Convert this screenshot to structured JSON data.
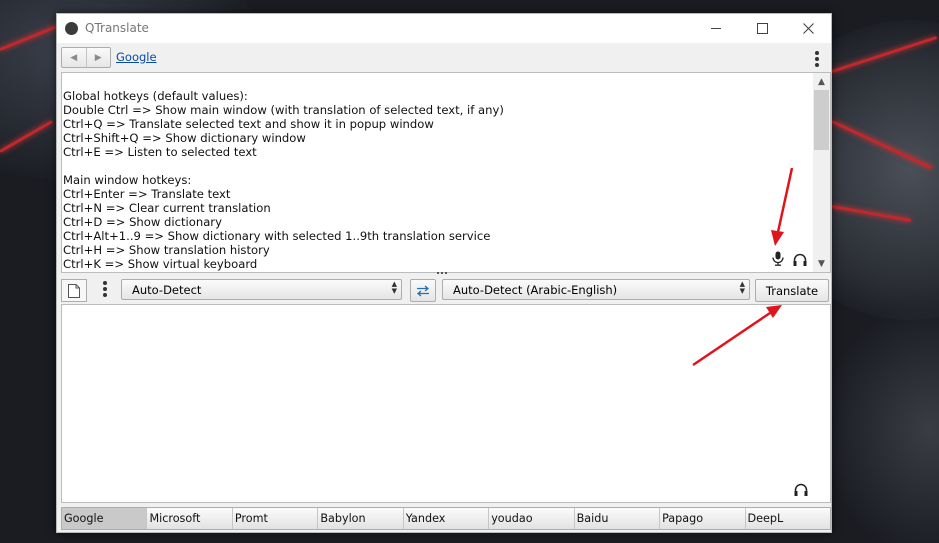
{
  "window": {
    "title": "QTranslate",
    "minimize": "minimize-icon",
    "maximize": "maximize-icon",
    "close": "close-icon"
  },
  "toolbar": {
    "back_icon": "chevron-left-icon",
    "forward_icon": "chevron-right-icon",
    "service_link": "Google",
    "menu_icon": "vertical-dots-icon"
  },
  "source": {
    "text": "Global hotkeys (default values):\nDouble Ctrl => Show main window (with translation of selected text, if any)\nCtrl+Q => Translate selected text and show it in popup window\nCtrl+Shift+Q => Show dictionary window\nCtrl+E => Listen to selected text\n\nMain window hotkeys:\nCtrl+Enter => Translate text\nCtrl+N => Clear current translation\nCtrl+D => Show dictionary\nCtrl+Alt+1..9 => Show dictionary with selected 1..9th translation service\nCtrl+H => Show translation history\nCtrl+K => Show virtual keyboard",
    "mic_icon": "microphone-icon",
    "listen_icon": "headphones-icon"
  },
  "controls": {
    "new_icon": "document-icon",
    "menu_icon": "vertical-dots-icon",
    "source_lang": "Auto-Detect",
    "swap_icon": "swap-arrows-icon",
    "target_lang": "Auto-Detect (Arabic-English)",
    "translate_label": "Translate"
  },
  "result": {
    "text": "",
    "listen_icon": "headphones-icon"
  },
  "services": {
    "items": [
      "Google",
      "Microsoft",
      "Promt",
      "Babylon",
      "Yandex",
      "youdao",
      "Baidu",
      "Papago",
      "DeepL"
    ],
    "active": "Google"
  },
  "colors": {
    "annotation_arrow": "#e0141b",
    "link": "#0b4aa8",
    "active_tab": "#c9c9c9"
  }
}
